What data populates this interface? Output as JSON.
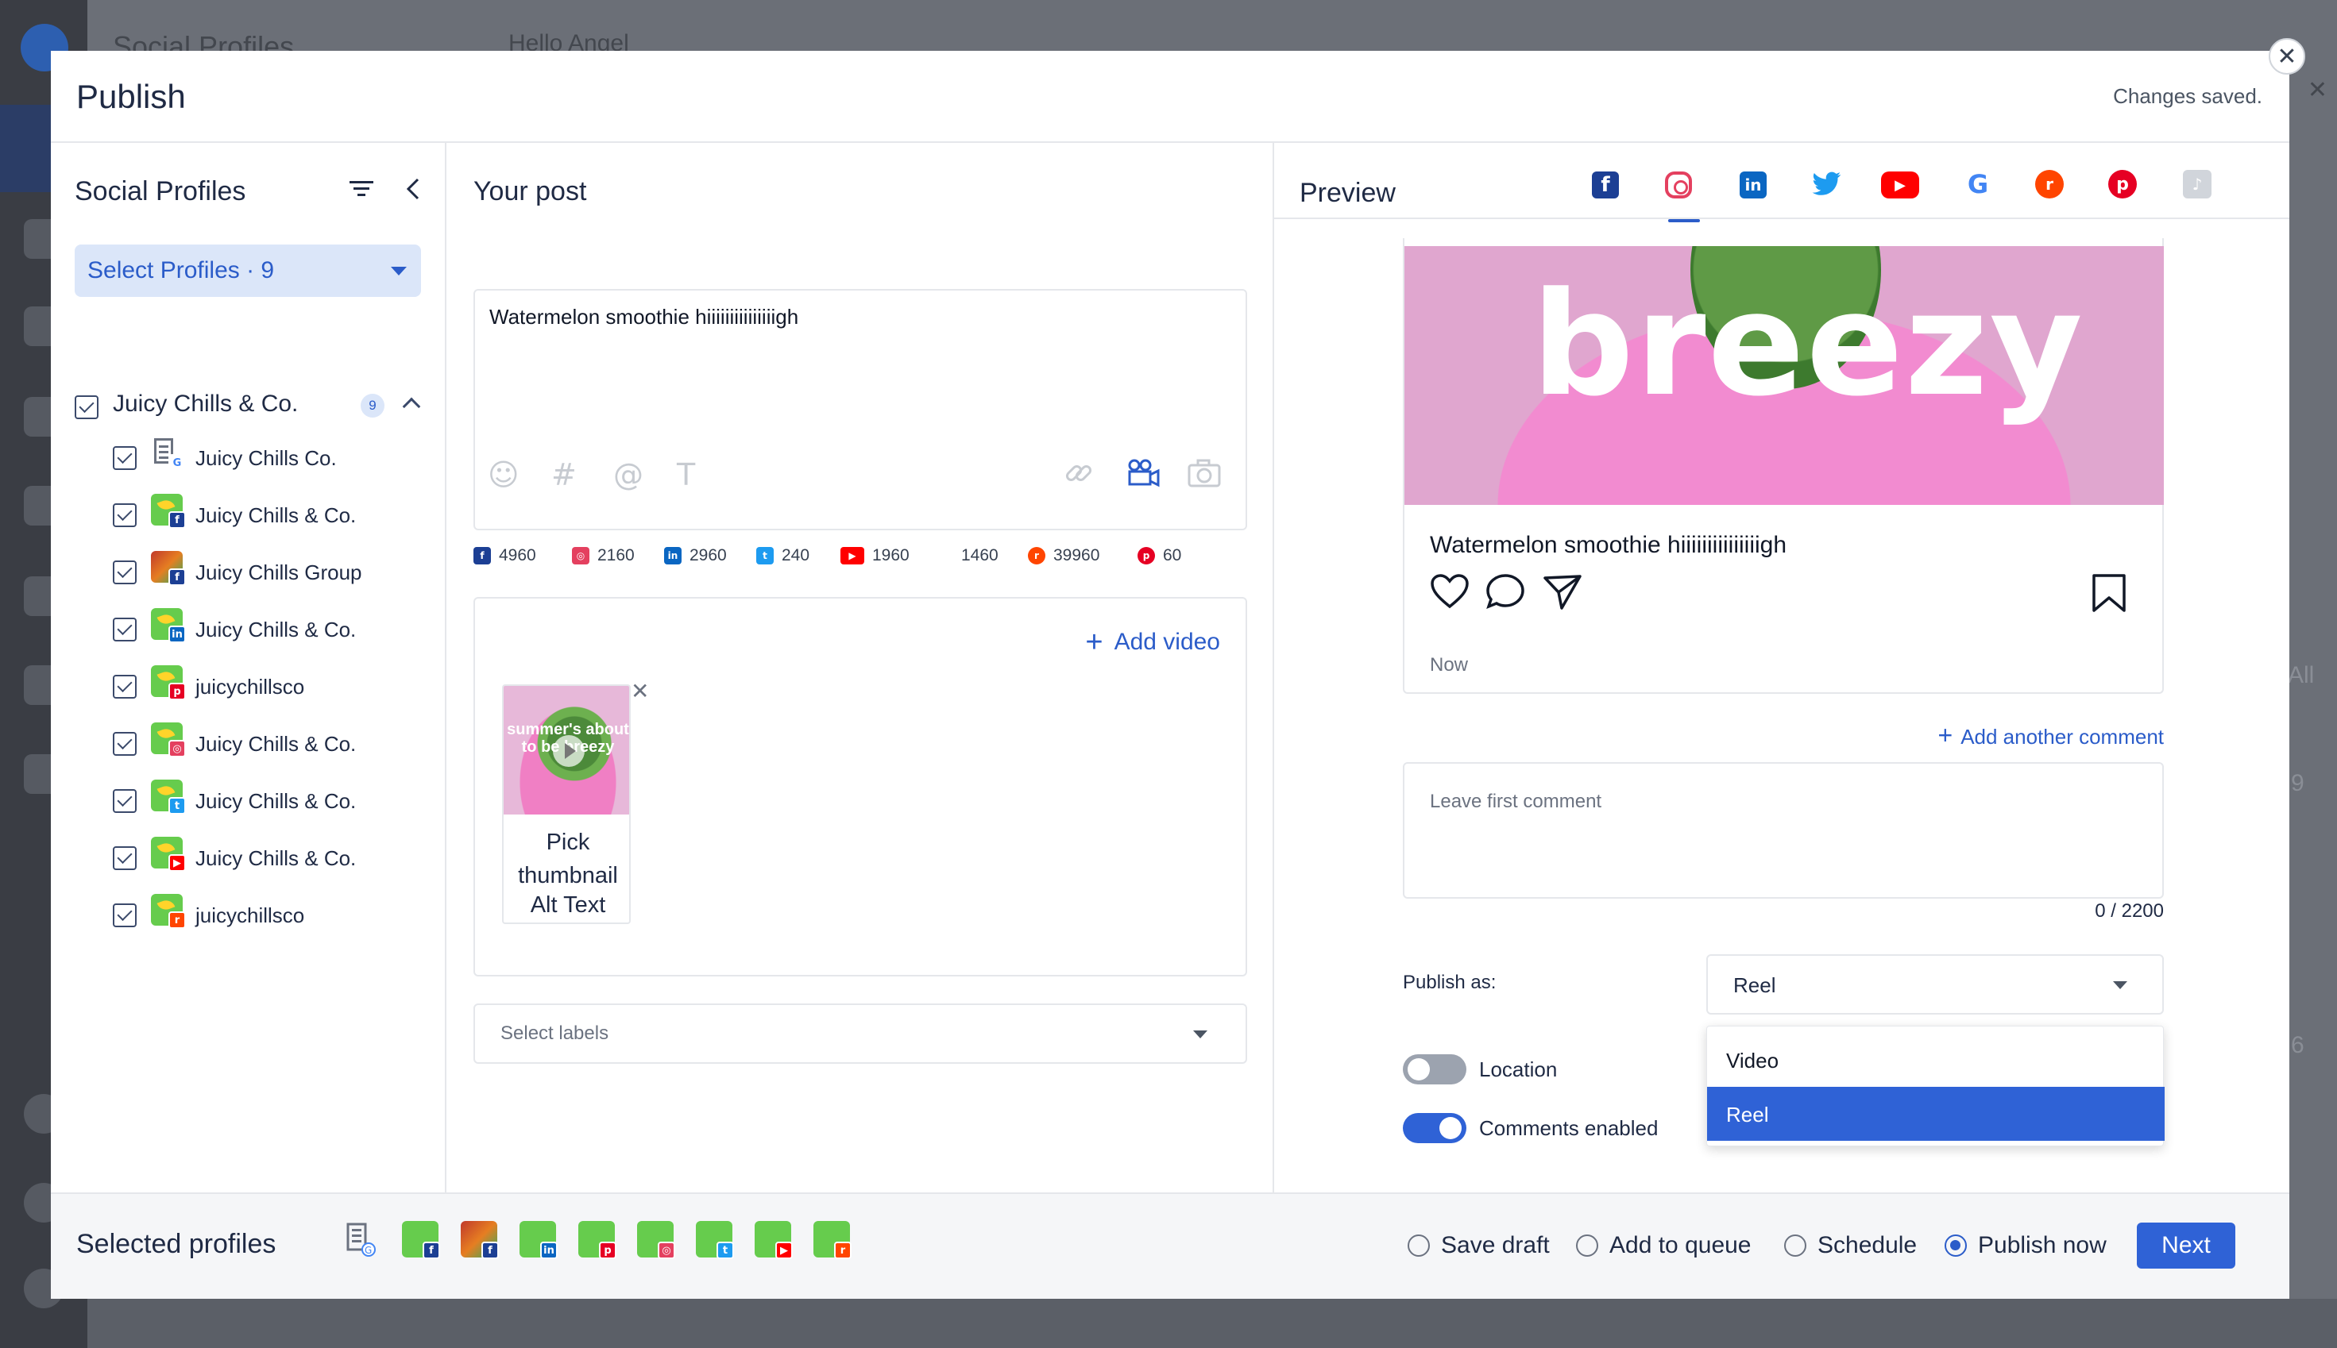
{
  "background": {
    "title": "Social Profiles",
    "subtitle": "Hello Angel",
    "right_text_1": "All",
    "right_text_2": "9",
    "right_text_3": "6"
  },
  "modal": {
    "title": "Publish",
    "status": "Changes saved.",
    "close_icon": "close-icon"
  },
  "profiles_panel": {
    "title": "Social Profiles",
    "select_label": "Select Profiles · 9",
    "group": {
      "name": "Juicy Chills & Co.",
      "count": "9"
    },
    "items": [
      {
        "name": "Juicy Chills Co.",
        "network": "google"
      },
      {
        "name": "Juicy Chills & Co.",
        "network": "facebook"
      },
      {
        "name": "Juicy Chills Group",
        "network": "facebook"
      },
      {
        "name": "Juicy Chills & Co.",
        "network": "linkedin"
      },
      {
        "name": "juicychillsco",
        "network": "pinterest"
      },
      {
        "name": "Juicy Chills & Co.",
        "network": "instagram"
      },
      {
        "name": "Juicy Chills & Co.",
        "network": "twitter"
      },
      {
        "name": "Juicy Chills & Co.",
        "network": "youtube"
      },
      {
        "name": "juicychillsco",
        "network": "reddit"
      }
    ]
  },
  "post_panel": {
    "title": "Your post",
    "text": "Watermelon smoothie hiiiiiiiiiiiiiiigh",
    "char_counts": [
      {
        "network": "facebook",
        "value": "4960"
      },
      {
        "network": "instagram",
        "value": "2160"
      },
      {
        "network": "linkedin",
        "value": "2960"
      },
      {
        "network": "twitter",
        "value": "240"
      },
      {
        "network": "youtube",
        "value": "1960"
      },
      {
        "network": "google",
        "value": "1460"
      },
      {
        "network": "reddit",
        "value": "39960"
      },
      {
        "network": "pinterest",
        "value": "60"
      }
    ],
    "add_video": "Add video",
    "thumbnail_text": "summer's about to be breezy",
    "pick_thumbnail": "Pick thumbnail",
    "alt_text": "Alt Text",
    "labels_placeholder": "Select labels"
  },
  "preview_panel": {
    "title": "Preview",
    "active_network": "instagram",
    "image_text": "breezy",
    "caption": "Watermelon smoothie hiiiiiiiiiiiiiiigh",
    "timestamp": "Now",
    "add_comment": "Add another comment",
    "comment_placeholder": "Leave first comment",
    "comment_count": "0 / 2200",
    "publish_as_label": "Publish as:",
    "publish_as_value": "Reel",
    "publish_as_options": [
      "Video",
      "Reel"
    ],
    "location_label": "Location",
    "location_enabled": false,
    "comments_label": "Comments enabled",
    "comments_enabled": true
  },
  "footer": {
    "title": "Selected profiles",
    "options": [
      "Save draft",
      "Add to queue",
      "Schedule",
      "Publish now"
    ],
    "selected_option": "Publish now",
    "next_label": "Next"
  },
  "colors": {
    "accent": "#2f62d6",
    "brand_green": "#66cc4d"
  }
}
